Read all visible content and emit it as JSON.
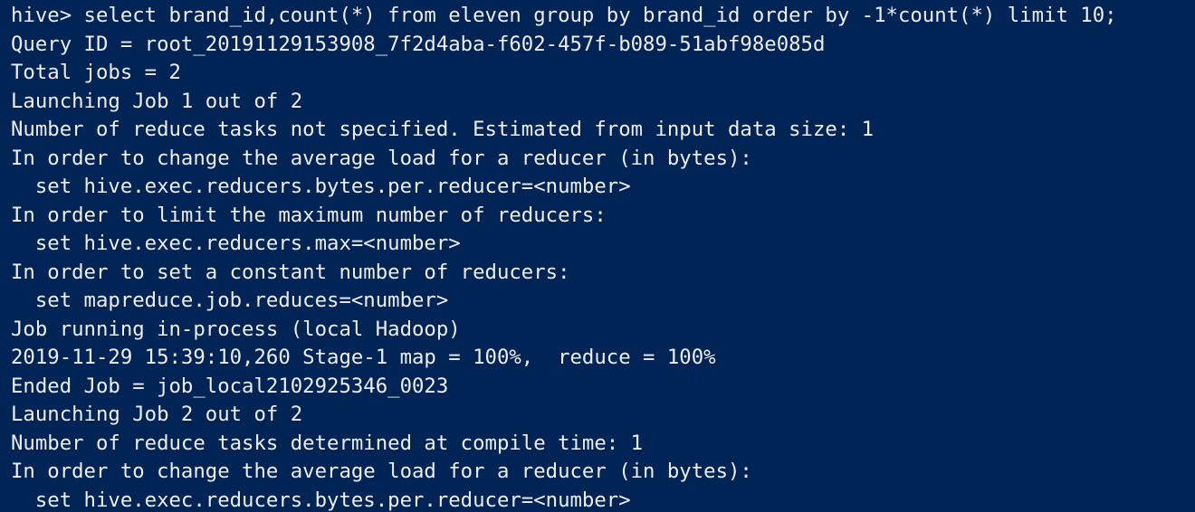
{
  "terminal": {
    "background_color": "#012456",
    "text_color": "#eeedf0",
    "lines": [
      "hive> select brand_id,count(*) from eleven group by brand_id order by -1*count(*) limit 10;",
      "Query ID = root_20191129153908_7f2d4aba-f602-457f-b089-51abf98e085d",
      "Total jobs = 2",
      "Launching Job 1 out of 2",
      "Number of reduce tasks not specified. Estimated from input data size: 1",
      "In order to change the average load for a reducer (in bytes):",
      "  set hive.exec.reducers.bytes.per.reducer=<number>",
      "In order to limit the maximum number of reducers:",
      "  set hive.exec.reducers.max=<number>",
      "In order to set a constant number of reducers:",
      "  set mapreduce.job.reduces=<number>",
      "Job running in-process (local Hadoop)",
      "2019-11-29 15:39:10,260 Stage-1 map = 100%,  reduce = 100%",
      "Ended Job = job_local2102925346_0023",
      "Launching Job 2 out of 2",
      "Number of reduce tasks determined at compile time: 1",
      "In order to change the average load for a reducer (in bytes):",
      "  set hive.exec.reducers.bytes.per.reducer=<number>"
    ]
  }
}
